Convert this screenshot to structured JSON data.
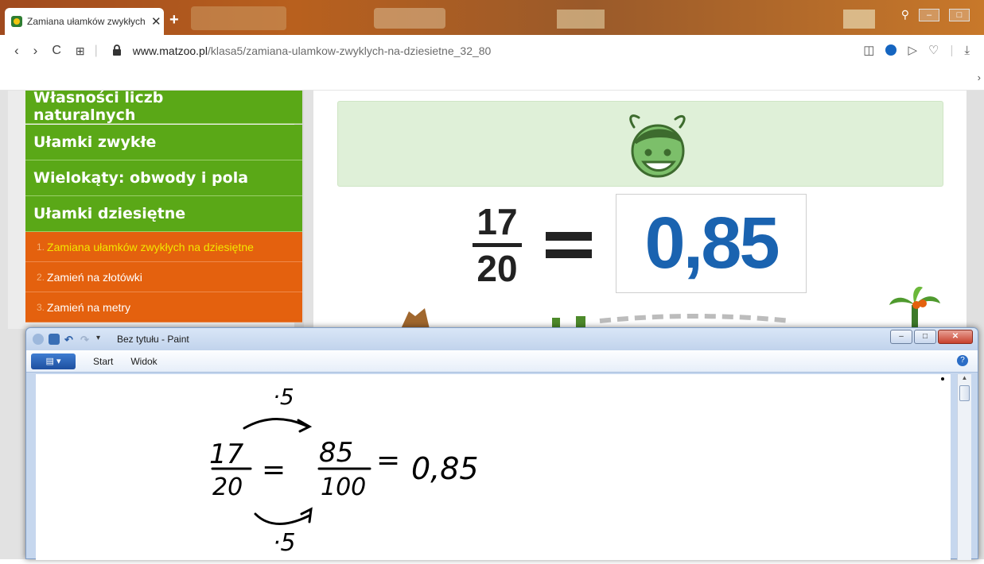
{
  "browser": {
    "tab_title": "Zamiana ułamków zwykłych",
    "tab_close": "✕",
    "new_tab": "+",
    "url_host": "www.matzoo.pl",
    "url_path": "/klasa5/zamiana-ulamkow-zwyklych-na-dziesietne_32_80",
    "nav_back": "‹",
    "nav_forward": "›",
    "nav_reload": "C",
    "nav_grid": "⊞",
    "bookmark_chevron": "›"
  },
  "sidebar": {
    "categories": [
      {
        "label": "Własności liczb naturalnych"
      },
      {
        "label": "Ułamki zwykłe"
      },
      {
        "label": "Wielokąty: obwody i pola"
      },
      {
        "label": "Ułamki dziesiętne"
      }
    ],
    "subitems": [
      {
        "num": "1.",
        "label": "Zamiana ułamków zwykłych na dziesiętne",
        "active": true
      },
      {
        "num": "2.",
        "label": "Zamień na złotówki"
      },
      {
        "num": "3.",
        "label": "Zamień na metry"
      }
    ]
  },
  "exercise": {
    "numerator": "17",
    "denominator": "20",
    "answer": "0,85"
  },
  "paint": {
    "title": "Bez tytułu - Paint",
    "tabs": [
      "Start",
      "Widok"
    ],
    "help": "?",
    "drawing": {
      "multiplier_top": "·5",
      "multiplier_bottom": "·5",
      "frac1_num": "17",
      "frac1_den": "20",
      "frac2_num": "85",
      "frac2_den": "100",
      "result": "0,85"
    }
  },
  "colors": {
    "menu_green": "#5aa817",
    "menu_orange": "#e4610e",
    "active_item": "#f3e600",
    "answer_blue": "#1a63b0"
  }
}
